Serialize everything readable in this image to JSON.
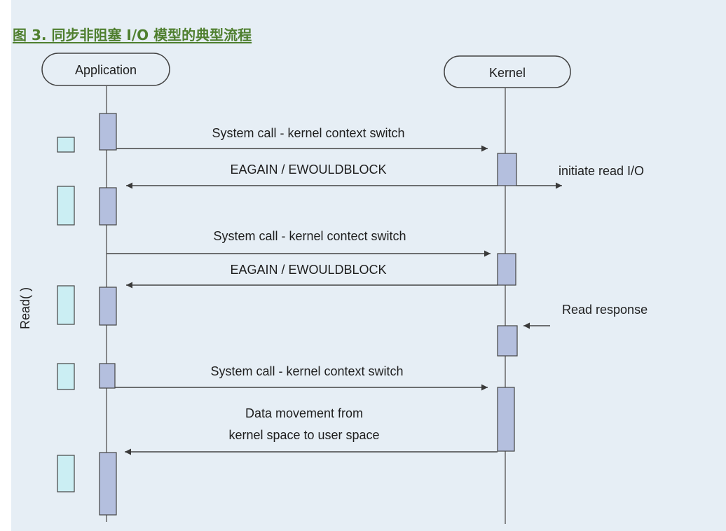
{
  "figure": {
    "title": "图 3. 同步非阻塞 I/O 模型的典型流程"
  },
  "participants": {
    "application": "Application",
    "kernel": "Kernel"
  },
  "side_label": "Read( )",
  "messages": {
    "syscall_1": "System call - kernel context switch",
    "eagain_1": "EAGAIN / EWOULDBLOCK",
    "initiate_read": "initiate read I/O",
    "syscall_2": "System call - kernel contect switch",
    "eagain_2": "EAGAIN / EWOULDBLOCK",
    "read_response": "Read response",
    "syscall_3": "System call - kernel context switch",
    "data_movement_line1": "Data movement from",
    "data_movement_line2": "kernel space to user space"
  },
  "colors": {
    "title": "#4f7f2f",
    "background": "#e6eef5",
    "activation_fill": "#b4bfde",
    "app_block_fill": "#cbeef3",
    "line": "#555555"
  }
}
